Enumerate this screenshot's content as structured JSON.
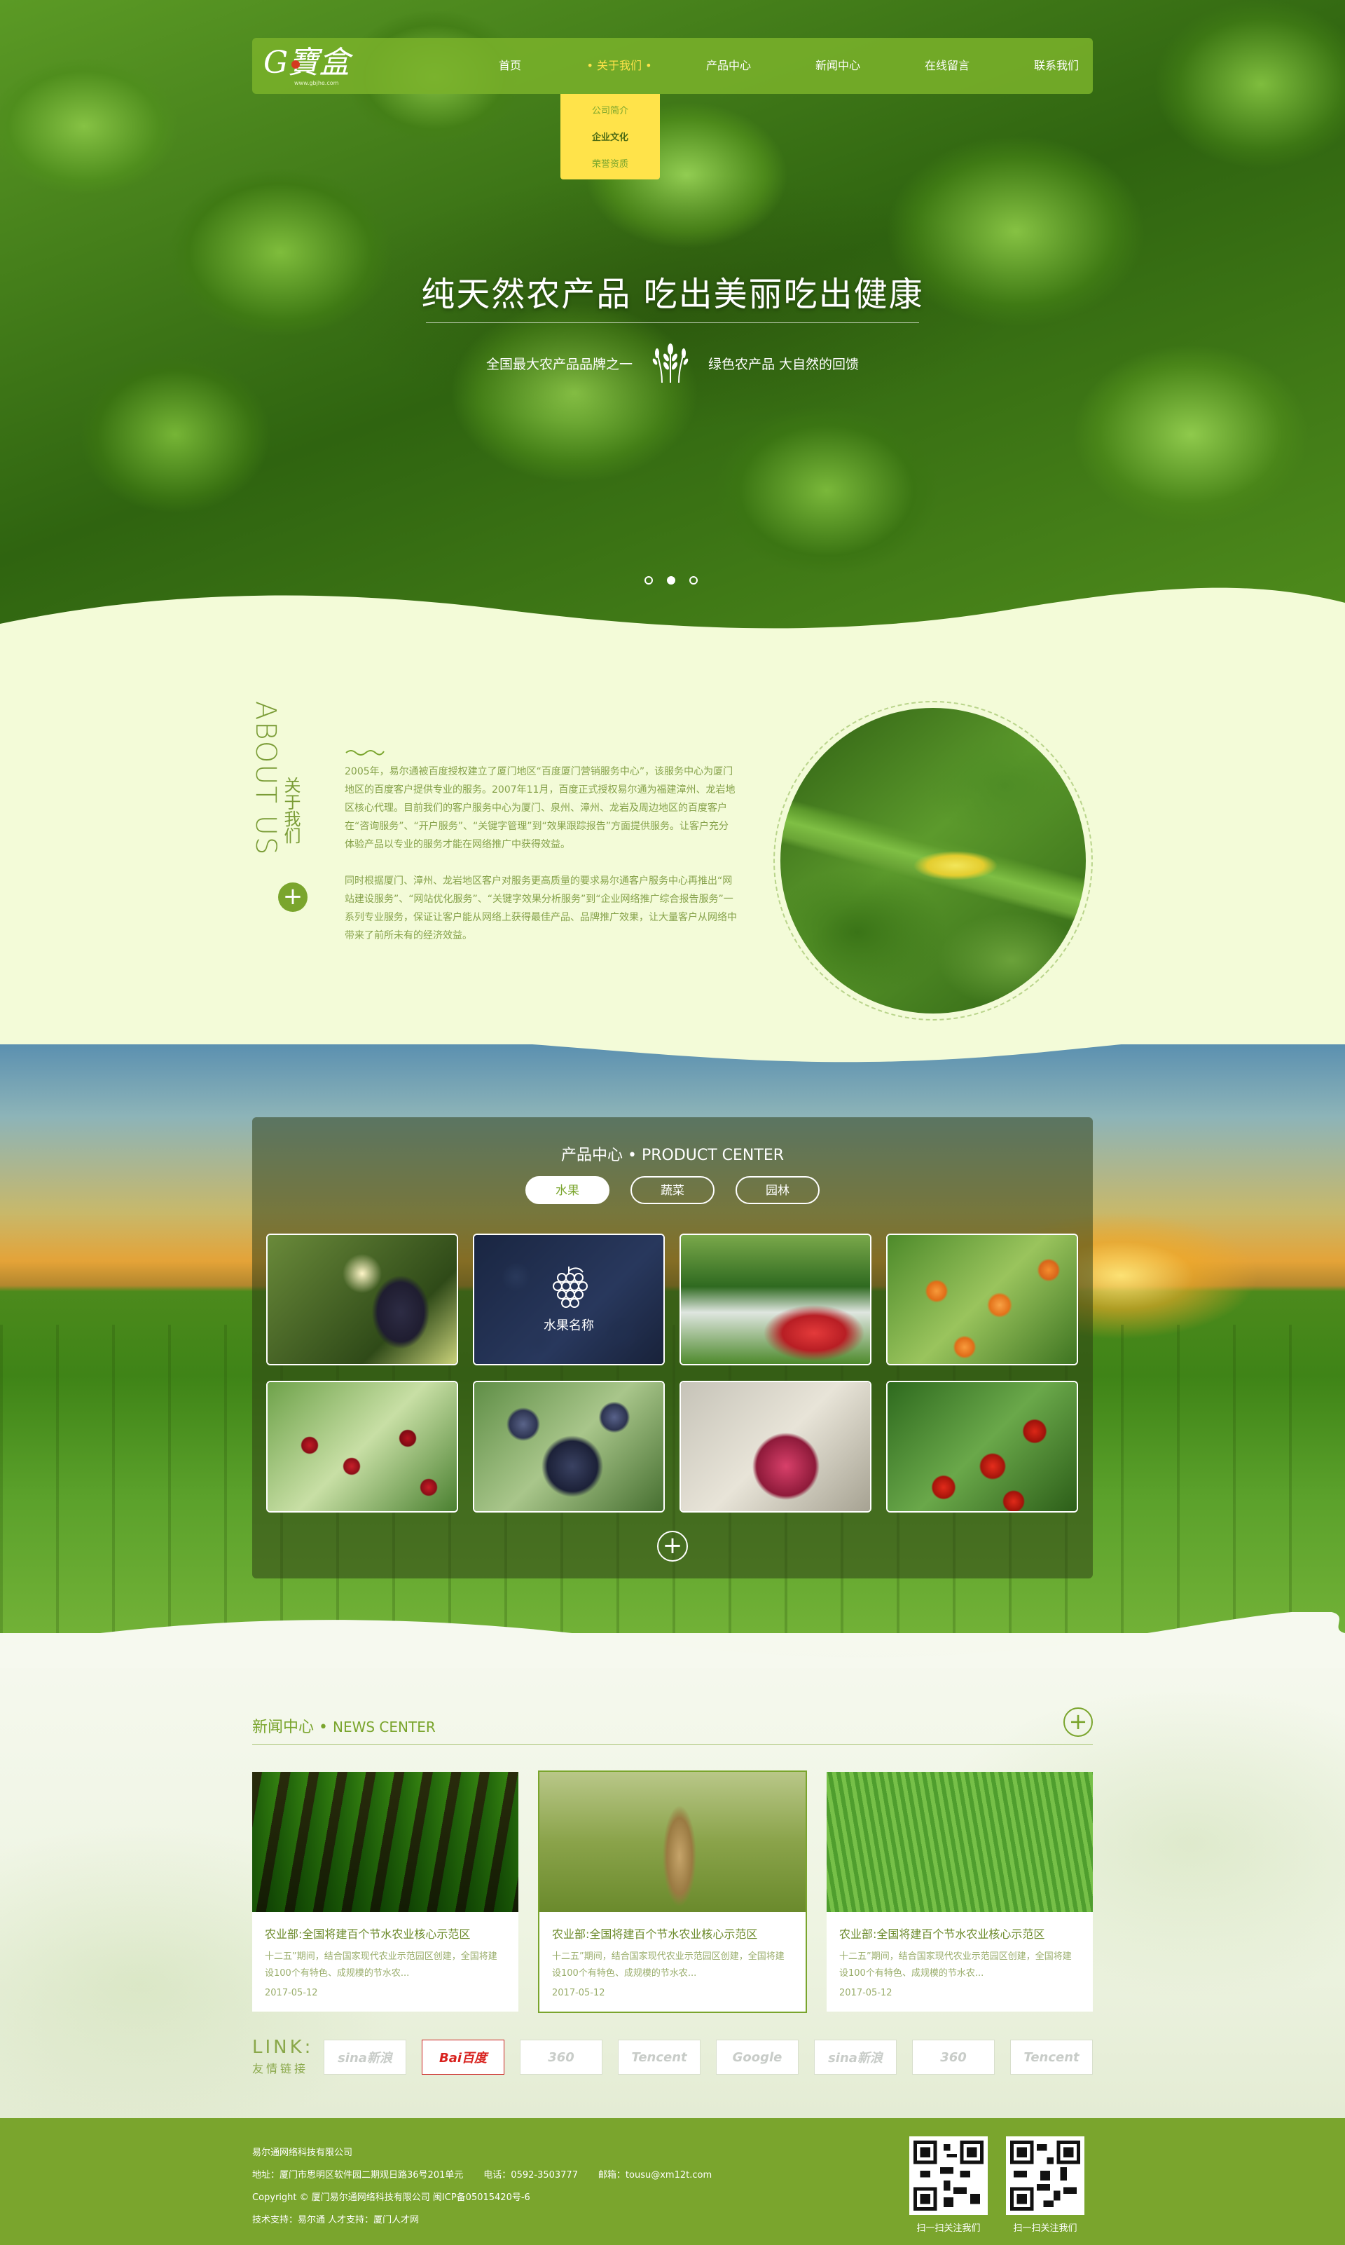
{
  "brand": {
    "logo_text": "G寶盒",
    "logo_sub": "www.gbjhe.com"
  },
  "nav": {
    "items": [
      "首页",
      "关于我们",
      "产品中心",
      "新闻中心",
      "在线留言",
      "联系我们"
    ],
    "active_index": 1,
    "dropdown": [
      "公司简介",
      "企业文化",
      "荣誉资质"
    ],
    "dropdown_active_index": 1
  },
  "hero": {
    "title": "纯天然农产品 吃出美丽吃出健康",
    "sub_left": "全国最大农产品品牌之一",
    "sub_right": "绿色农产品  大自然的回馈",
    "slides": 3,
    "active_slide": 1
  },
  "about": {
    "title_en": "ABOUT US",
    "title_cn": "关于我们",
    "para1": "2005年，易尔通被百度授权建立了厦门地区“百度厦门营销服务中心”，该服务中心为厦门地区的百度客户提供专业的服务。2007年11月，百度正式授权易尔通为福建漳州、龙岩地区核心代理。目前我们的客户服务中心为厦门、泉州、漳州、龙岩及周边地区的百度客户在“咨询服务”、“开户服务”、“关键字管理”到“效果跟踪报告”方面提供服务。让客户充分体验产品以专业的服务才能在网络推广中获得效益。",
    "para2": "同时根据厦门、漳州、龙岩地区客户对服务更高质量的要求易尔通客户服务中心再推出“网站建设服务”、“网站优化服务”、“关键字效果分析服务”到“企业网络推广综合报告服务”一系列专业服务，保证让客户能从网络上获得最佳产品、品牌推广效果，让大量客户从网络中带来了前所未有的经济效益。"
  },
  "products": {
    "title_cn": "产品中心",
    "title_en": "PRODUCT CENTER",
    "tabs": [
      "水果",
      "蔬菜",
      "园林"
    ],
    "active_tab": 0,
    "hover_label": "水果名称"
  },
  "news": {
    "title_cn": "新闻中心",
    "title_en": "NEWS CENTER",
    "items": [
      {
        "title": "农业部:全国将建百个节水农业核心示范区",
        "desc": "十二五”期间，结合国家现代农业示范园区创建，全国将建设100个有特色、成规模的节水农...",
        "date": "2017-05-12"
      },
      {
        "title": "农业部:全国将建百个节水农业核心示范区",
        "desc": "十二五”期间，结合国家现代农业示范园区创建，全国将建设100个有特色、成规模的节水农...",
        "date": "2017-05-12"
      },
      {
        "title": "农业部:全国将建百个节水农业核心示范区",
        "desc": "十二五”期间，结合国家现代农业示范园区创建，全国将建设100个有特色、成规模的节水农...",
        "date": "2017-05-12"
      }
    ],
    "active_index": 1
  },
  "links": {
    "label_en": "LINK:",
    "label_cn": "友情链接",
    "partners": [
      "sina新浪",
      "Bai百度",
      "360",
      "Tencent",
      "Google",
      "sina新浪",
      "360",
      "Tencent"
    ],
    "active_index": 1
  },
  "footer": {
    "company": "易尔通网络科技有限公司",
    "address": "地址：厦门市思明区软件园二期观日路36号201单元",
    "phone": "电话：0592-3503777",
    "email": "邮箱：tousu@xm12t.com",
    "copyright": "Copyright © 厦门易尔通网络科技有限公司  闽ICP备05015420号-6",
    "support": "技术支持：易尔通    人才支持：厦门人才网",
    "qr_labels": [
      "扫一扫关注我们",
      "扫一扫关注我们"
    ]
  },
  "colors": {
    "brand_green": "#7aa52d",
    "accent_yellow": "#ffe34a",
    "bg_light": "#f3fbd8"
  }
}
